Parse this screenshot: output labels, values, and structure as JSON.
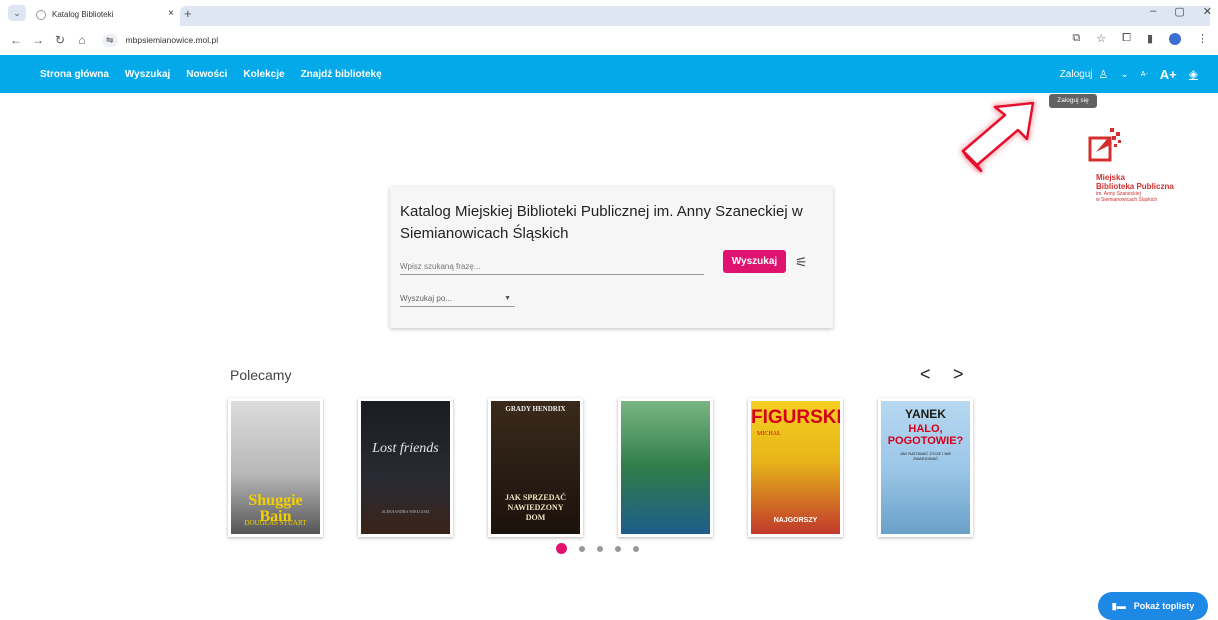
{
  "browser": {
    "tab_title": "Katalog Biblioteki",
    "tab_close": "×",
    "new_tab": "+",
    "url": "mbpsiemianowice.mol.pl",
    "window_controls": [
      "–",
      "▢",
      "✕"
    ]
  },
  "navbar": {
    "items": [
      "Strona główna",
      "Wyszukaj",
      "Nowości",
      "Kolekcje",
      "Znajdź bibliotekę"
    ],
    "login_label": "Zaloguj",
    "font_small": "A-",
    "font_large": "A+",
    "login_tooltip": "Zaloguj się",
    "accent_color": "#03a9e8"
  },
  "logo": {
    "title_line1": "Miejska",
    "title_line2": "Biblioteka Publiczna",
    "sub_line1": "im. Anny Szaneckiej",
    "sub_line2": "w Siemianowicach Śląskich"
  },
  "search": {
    "title": "Katalog Miejskiej Biblioteki Publicznej im. Anny Szaneckiej w Siemianowicach Śląskich",
    "input_placeholder": "Wpisz szukaną frazę...",
    "button_label": "Wyszukaj",
    "search_by_placeholder": "Wyszukaj po...",
    "button_color": "#e0126f"
  },
  "recommended": {
    "title": "Polecamy",
    "prev": "<",
    "next": ">",
    "books": [
      {
        "title": "Shuggie Bain",
        "author": "DOUGLAS STUART"
      },
      {
        "title": "Lost friends",
        "author": "ALEKSANDRA WIELGOSZ"
      },
      {
        "title": "JAK SPRZEDAĆ NAWIEDZONY DOM",
        "author": "GRADY HENDRIX"
      },
      {
        "title": "",
        "author": ""
      },
      {
        "title": "FIGURSKI",
        "author": "MICHAŁ",
        "badge": "NAJGORSZY"
      },
      {
        "title": "HALO, POGOTOWIE?",
        "author": "YANEK",
        "subtitle": "JAK RATOWAĆ ŻYCIE I NIE ZWARIOWAĆ"
      }
    ],
    "carousel_pages": 5,
    "active_page": 1
  },
  "toplist_button": "Pokaż toplisty"
}
